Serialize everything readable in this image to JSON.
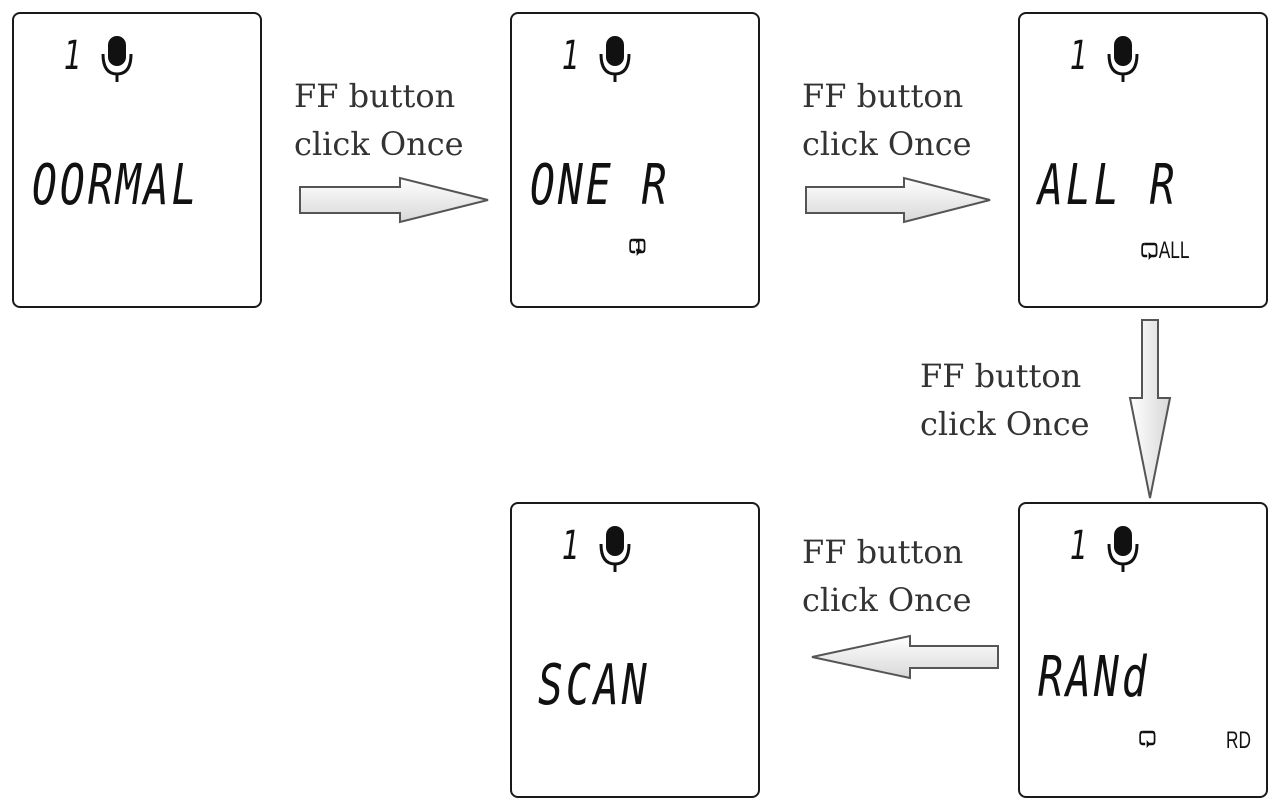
{
  "panels": [
    {
      "folder": "1",
      "mode": "OORMAL",
      "sub": ""
    },
    {
      "folder": "1",
      "mode": "ONE R",
      "sub": "1"
    },
    {
      "folder": "1",
      "mode": "ALL R",
      "sub": "ALL"
    },
    {
      "folder": "1",
      "mode": "RANd",
      "sub": "RD"
    },
    {
      "folder": "1",
      "mode": "SCAN",
      "sub": ""
    }
  ],
  "labels": [
    {
      "line1": "FF button",
      "line2": "click Once"
    },
    {
      "line1": "FF button",
      "line2": "click Once"
    },
    {
      "line1": "FF button",
      "line2": "click Once"
    },
    {
      "line1": "FF button",
      "line2": "click Once"
    }
  ],
  "icons": {
    "mic": "microphone-icon",
    "repeat": "repeat-icon"
  },
  "colors": {
    "border": "#1a1a1a",
    "arrow_fill": "#f2f2f2",
    "arrow_stroke": "#555555",
    "text": "#333333"
  }
}
